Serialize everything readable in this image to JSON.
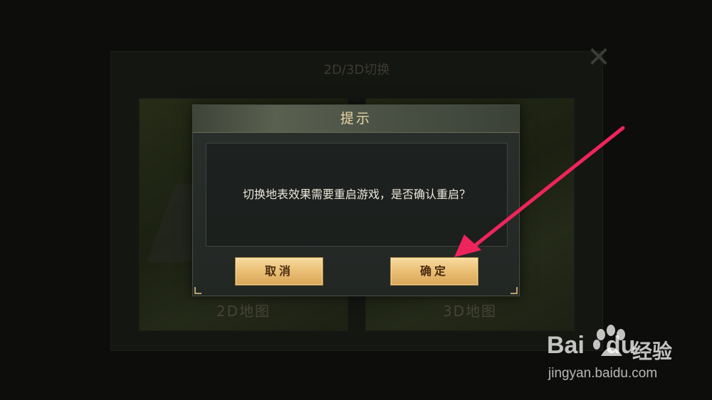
{
  "background_screen": {
    "title": "2D/3D切换",
    "left_map_label": "2D地图",
    "right_map_label": "3D地图",
    "close_icon": "close-icon"
  },
  "dialog": {
    "title": "提示",
    "message": "切换地表效果需要重启游戏，是否确认重启？",
    "cancel_label": "取消",
    "confirm_label": "确定"
  },
  "annotation": {
    "arrow_color": "#f0245c",
    "arrow_target": "confirm-button"
  },
  "watermark": {
    "brand_latin": "Bai",
    "brand_du": "du",
    "brand_cn": "经验",
    "url": "jingyan.baidu.com"
  },
  "colors": {
    "button_gold": "#ebc177",
    "title_text": "#e8d7a8",
    "dialog_bg": "#252a27"
  }
}
